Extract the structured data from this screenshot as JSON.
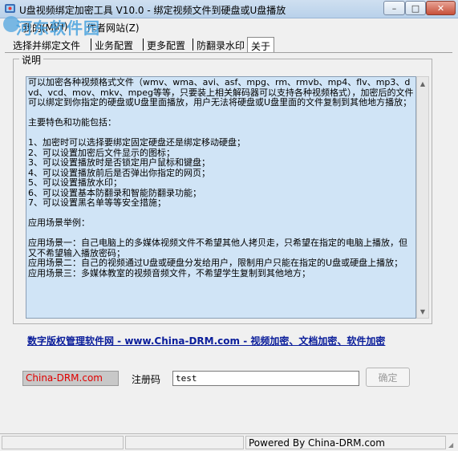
{
  "window": {
    "title": "U盘视频绑定加密工具 V10.0 - 绑定视频文件到硬盘或U盘播放",
    "watermark": "河东软件园",
    "buttons": {
      "minimize": "–",
      "maximize": "□",
      "close": "✕"
    }
  },
  "menu": [
    "我的(M)",
    "(H)",
    "作者网站(Z)"
  ],
  "tabs": [
    "选择并绑定文件",
    "业务配置",
    "更多配置",
    "防翻录水印",
    "关于"
  ],
  "active_tab": 4,
  "about": {
    "group_title": "说明",
    "description": "可以加密各种视频格式文件（wmv、wma、avi、asf、mpg、rm、rmvb、mp4、flv、mp3、dvd、vcd、mov、mkv、mpeg等等，只要装上相关解码器可以支持各种视频格式），加密后的文件可以绑定到你指定的硬盘或U盘里面播放，用户无法将硬盘或U盘里面的文件复制到其他地方播放；\n\n主要特色和功能包括：\n\n1、加密时可以选择要绑定固定硬盘还是绑定移动硬盘；\n2、可以设置加密后文件显示的图标；\n3、可以设置播放时是否锁定用户鼠标和键盘；\n4、可以设置播放前后是否弹出你指定的网页；\n5、可以设置播放水印；\n6、可以设置基本防翻录和智能防翻录功能；\n7、可以设置黑名单等等安全措施；\n\n应用场景举例：\n\n应用场景一：自己电脑上的多媒体视频文件不希望其他人拷贝走，只希望在指定的电脑上播放，但又不希望输入播放密码；\n应用场景二：自己的视频通过U盘或硬盘分发给用户，限制用户只能在指定的U盘或硬盘上播放；\n应用场景三：多媒体教室的视频音频文件，不希望学生复制到其他地方；",
    "link_text": "数字版权管理软件网 - www.China-DRM.com - 视频加密、文档加密、软件加密"
  },
  "registration": {
    "brand": "China-DRM.com",
    "label": "注册码",
    "value": "test",
    "ok_button": "确定"
  },
  "status_bar": {
    "left": "",
    "middle": "",
    "right": "Powered By China-DRM.com"
  },
  "colors": {
    "description_bg": "#d0e4f6",
    "link": "#0a1d9a",
    "brand_text": "#e00000"
  }
}
